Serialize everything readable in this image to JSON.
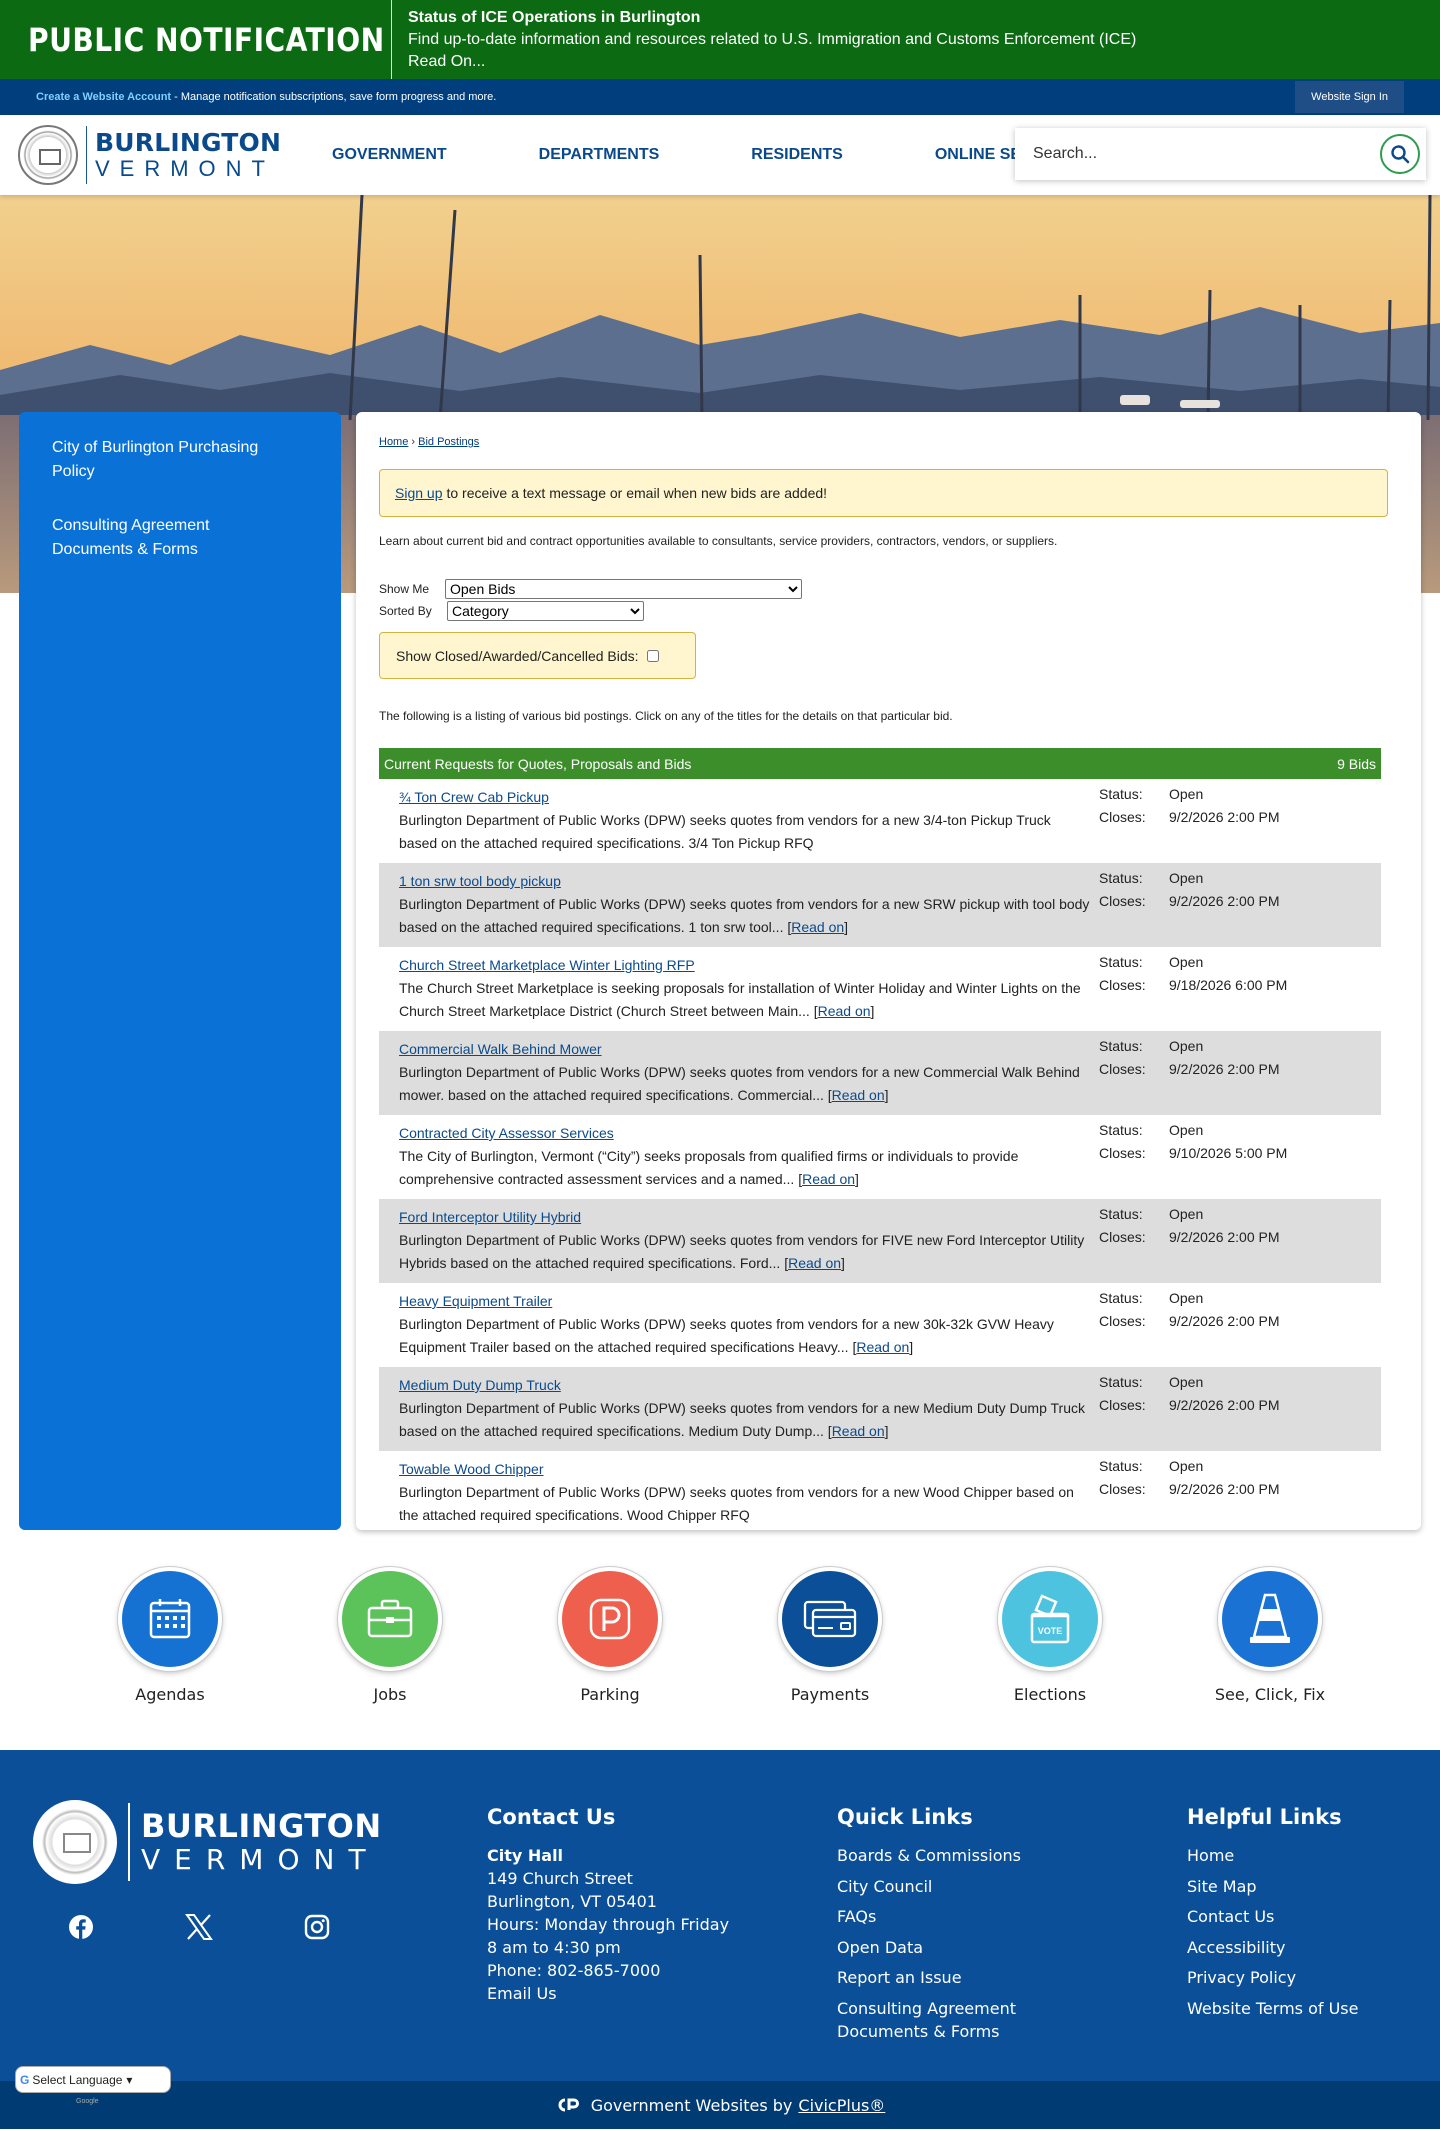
{
  "alert": {
    "brand": "PUBLIC NOTIFICATION",
    "title": "Status of ICE Operations in Burlington",
    "description": "Find up-to-date information and resources related to U.S. Immigration and Customs Enforcement (ICE)",
    "read_on": "Read On..."
  },
  "account_bar": {
    "create_link": "Create a Website Account",
    "create_desc": " - Manage notification subscriptions, save form progress and more.",
    "sign_in": "Website Sign In"
  },
  "header": {
    "logo_line1": "BURLINGTON",
    "logo_line2": "VERMONT",
    "nav": [
      "GOVERNMENT",
      "DEPARTMENTS",
      "RESIDENTS",
      "ONLINE SERVICES"
    ],
    "search_placeholder": "Search..."
  },
  "sidebar": {
    "items": [
      "City of Burlington Purchasing Policy",
      "Consulting Agreement Documents & Forms"
    ]
  },
  "breadcrumb": {
    "home": "Home",
    "sep": " › ",
    "current": "Bid Postings"
  },
  "signup": {
    "link": "Sign up",
    "text": "to receive a text message or email when new bids are added!"
  },
  "intro": "Learn about current bid and contract opportunities available to consultants, service providers, contractors, vendors, or suppliers.",
  "filters": {
    "show_me_label": "Show Me",
    "show_me_value": "Open Bids",
    "sorted_by_label": "Sorted By",
    "sorted_by_value": "Category",
    "closed_label": "Show Closed/Awarded/Cancelled Bids:"
  },
  "listing_note": "The following is a listing of various bid postings. Click on any of the titles for the details on that particular bid.",
  "bids": {
    "header_title": "Current Requests for Quotes, Proposals and Bids",
    "header_count": "9 Bids",
    "status_label": "Status:",
    "closes_label": "Closes:",
    "read_on": "Read on",
    "rows": [
      {
        "title": "¾ Ton Crew Cab Pickup",
        "desc": "Burlington Department of Public Works (DPW) seeks quotes from vendors for a new 3/4-ton Pickup Truck based on the attached required specifications. 3/4 Ton Pickup RFQ",
        "read": false,
        "status": "Open",
        "closes": "9/2/2026 2:00 PM"
      },
      {
        "title": "1 ton srw tool body pickup",
        "desc": "Burlington Department of Public Works (DPW) seeks quotes from vendors for a new SRW pickup with tool body based on the attached required specifications. 1 ton srw tool... ",
        "read": true,
        "status": "Open",
        "closes": "9/2/2026 2:00 PM"
      },
      {
        "title": "Church Street Marketplace Winter Lighting RFP",
        "desc": "The Church Street Marketplace is seeking proposals for installation of Winter Holiday and Winter Lights on the Church Street Marketplace District (Church Street between Main... ",
        "read": true,
        "status": "Open",
        "closes": "9/18/2026 6:00 PM"
      },
      {
        "title": "Commercial Walk Behind Mower",
        "desc": "Burlington Department of Public Works (DPW) seeks quotes from vendors for a new Commercial Walk Behind mower. based on the attached required specifications. Commercial... ",
        "read": true,
        "status": "Open",
        "closes": "9/2/2026 2:00 PM"
      },
      {
        "title": "Contracted City Assessor Services",
        "desc": "The City of Burlington, Vermont (“City”) seeks proposals from qualified firms or individuals to provide comprehensive contracted assessment services and a named... ",
        "read": true,
        "status": "Open",
        "closes": "9/10/2026 5:00 PM"
      },
      {
        "title": "Ford Interceptor Utility Hybrid",
        "desc": "Burlington Department of Public Works (DPW) seeks quotes from vendors for FIVE new Ford Interceptor Utility Hybrids based on the attached required specifications. Ford... ",
        "read": true,
        "status": "Open",
        "closes": "9/2/2026 2:00 PM"
      },
      {
        "title": "Heavy Equipment Trailer",
        "desc": "Burlington Department of Public Works (DPW) seeks quotes from vendors for a new 30k-32k GVW Heavy Equipment Trailer based on the attached required specifications Heavy... ",
        "read": true,
        "status": "Open",
        "closes": "9/2/2026 2:00 PM"
      },
      {
        "title": "Medium Duty Dump Truck",
        "desc": "Burlington Department of Public Works (DPW) seeks quotes from vendors for a new Medium Duty Dump Truck based on the attached required specifications. Medium Duty Dump... ",
        "read": true,
        "status": "Open",
        "closes": "9/2/2026 2:00 PM"
      },
      {
        "title": "Towable Wood Chipper",
        "desc": "Burlington Department of Public Works (DPW) seeks quotes from vendors for a new Wood Chipper based on the attached required specifications. Wood Chipper RFQ",
        "read": false,
        "status": "Open",
        "closes": "9/2/2026 2:00 PM"
      }
    ]
  },
  "quick_links": [
    {
      "label": "Agendas",
      "icon": "calendar-icon",
      "color": "#1572d3"
    },
    {
      "label": "Jobs",
      "icon": "briefcase-icon",
      "color": "#5cc25a"
    },
    {
      "label": "Parking",
      "icon": "parking-icon",
      "color": "#ef5f4d"
    },
    {
      "label": "Payments",
      "icon": "credit-card-icon",
      "color": "#0b4f98"
    },
    {
      "label": "Elections",
      "icon": "ballot-box-icon",
      "color": "#4ec3e0"
    },
    {
      "label": "See, Click, Fix",
      "icon": "traffic-cone-icon",
      "color": "#1a73d4"
    }
  ],
  "footer": {
    "logo_line1": "BURLINGTON",
    "logo_line2": "VERMONT",
    "contact": {
      "heading": "Contact Us",
      "name": "City Hall",
      "lines": [
        "149 Church Street",
        "Burlington, VT 05401",
        "Hours: Monday through Friday",
        "8 am to 4:30 pm",
        "Phone: 802-865-7000"
      ],
      "email": "Email Us"
    },
    "quick_links": {
      "heading": "Quick Links",
      "items": [
        "Boards & Commissions",
        "City Council",
        "FAQs",
        "Open Data",
        "Report an Issue",
        "Consulting Agreement Documents & Forms"
      ]
    },
    "helpful_links": {
      "heading": "Helpful Links",
      "items": [
        "Home",
        "Site Map",
        "Contact Us",
        "Accessibility",
        "Privacy Policy",
        "Website Terms of Use"
      ]
    },
    "language": "Select Language",
    "powered": "Google",
    "bottom_text": "Government Websites by",
    "bottom_link": "CivicPlus®"
  },
  "colors": {
    "alert_green": "#0b6a12",
    "navy": "#003e7e",
    "sidebar_blue": "#0a72d6",
    "table_header_green": "#3c8e2b",
    "footer_blue": "#0b4f98"
  }
}
